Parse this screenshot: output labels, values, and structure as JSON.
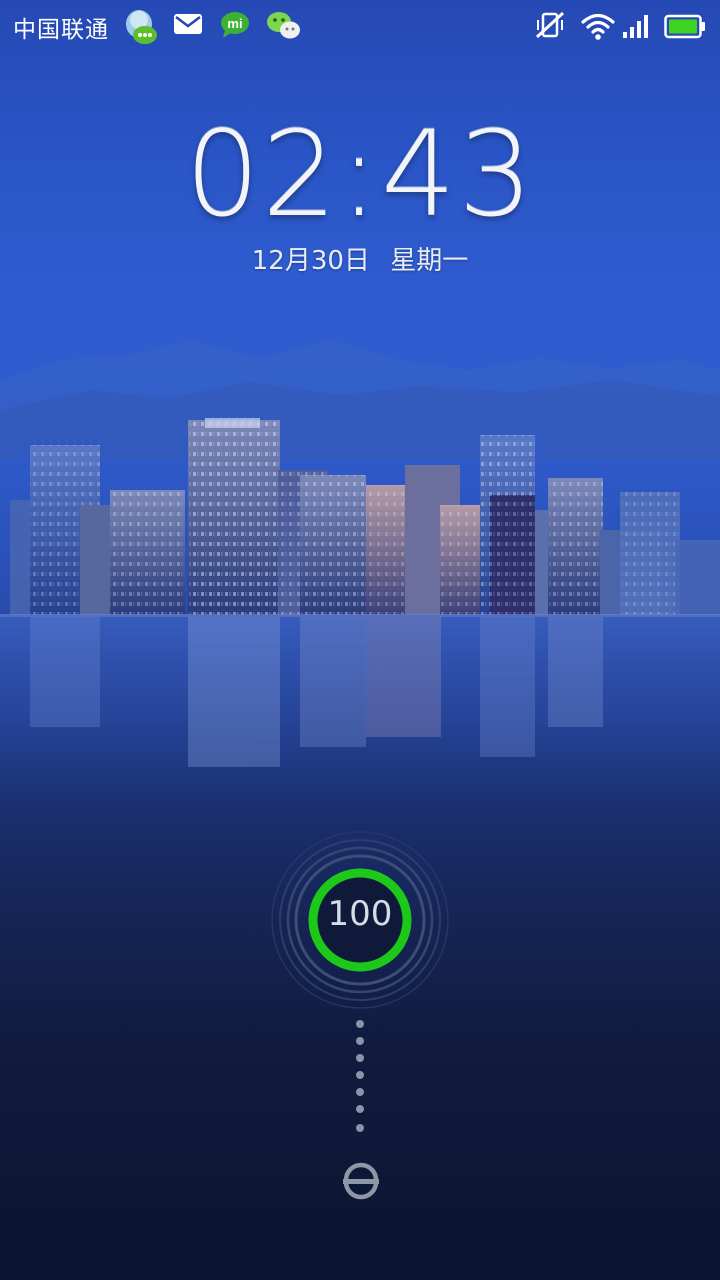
{
  "status_bar": {
    "carrier": "中国联通",
    "notification_icons": [
      "qq-chat-icon",
      "mail-icon",
      "mi-talk-icon",
      "wechat-icon"
    ],
    "system_icons": [
      "vibrate-off-icon",
      "wifi-icon",
      "signal-icon",
      "battery-icon"
    ]
  },
  "lockscreen": {
    "time": "02:43",
    "date": {
      "month_day": "12月30日",
      "weekday": "星期一"
    }
  },
  "charge": {
    "value": "100",
    "level": 1.0,
    "ring_color": "#1ec81a"
  },
  "colors": {
    "accent": "#1ec81a",
    "sky_top": "#2549b4",
    "bottom": "#0b1430"
  }
}
